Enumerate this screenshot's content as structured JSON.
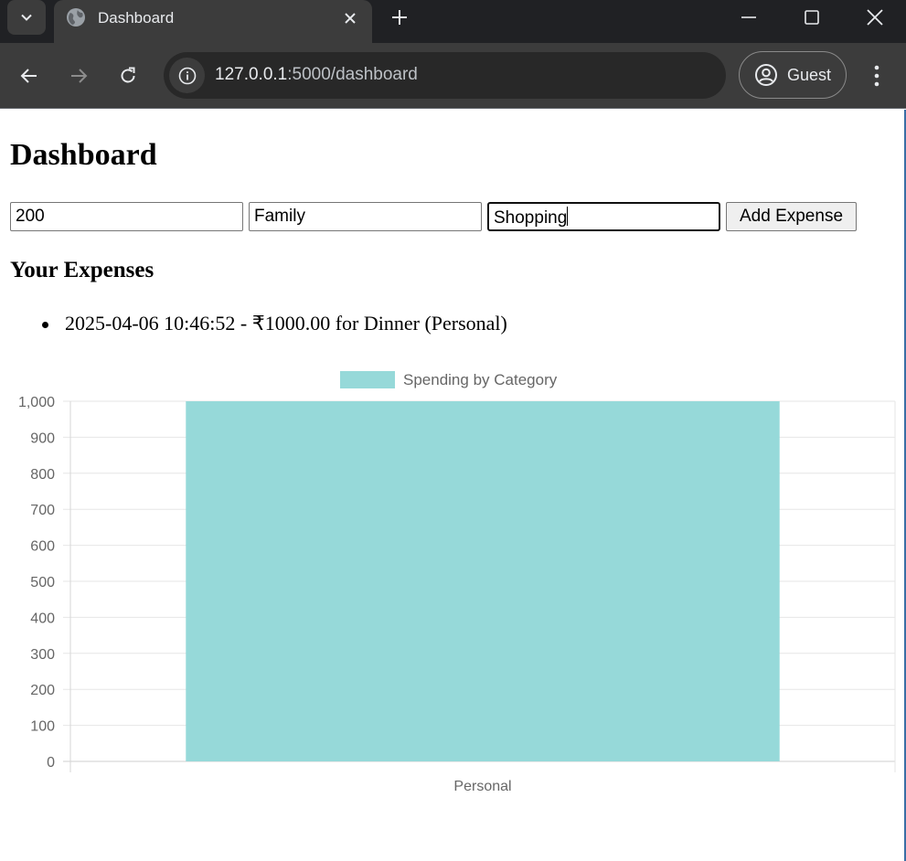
{
  "browser": {
    "tab_title": "Dashboard",
    "url_host": "127.0.0.1",
    "url_path": ":5000/dashboard",
    "profile_label": "Guest"
  },
  "page": {
    "title": "Dashboard",
    "form": {
      "amount_value": "200",
      "category_value": "Family",
      "description_value": "Shopping",
      "submit_label": "Add Expense"
    },
    "expenses_heading": "Your Expenses",
    "expenses": [
      "2025-04-06 10:46:52 - ₹1000.00 for Dinner (Personal)"
    ]
  },
  "chart_data": {
    "type": "bar",
    "categories": [
      "Personal"
    ],
    "series": [
      {
        "name": "Spending by Category",
        "values": [
          1000
        ],
        "color": "#96d9d9"
      }
    ],
    "ylim": [
      0,
      1000
    ],
    "yticks": [
      0,
      100,
      200,
      300,
      400,
      500,
      600,
      700,
      800,
      900,
      1000
    ],
    "ytick_labels": [
      "0",
      "100",
      "200",
      "300",
      "400",
      "500",
      "600",
      "700",
      "800",
      "900",
      "1,000"
    ],
    "legend_position": "top",
    "grid": true
  }
}
